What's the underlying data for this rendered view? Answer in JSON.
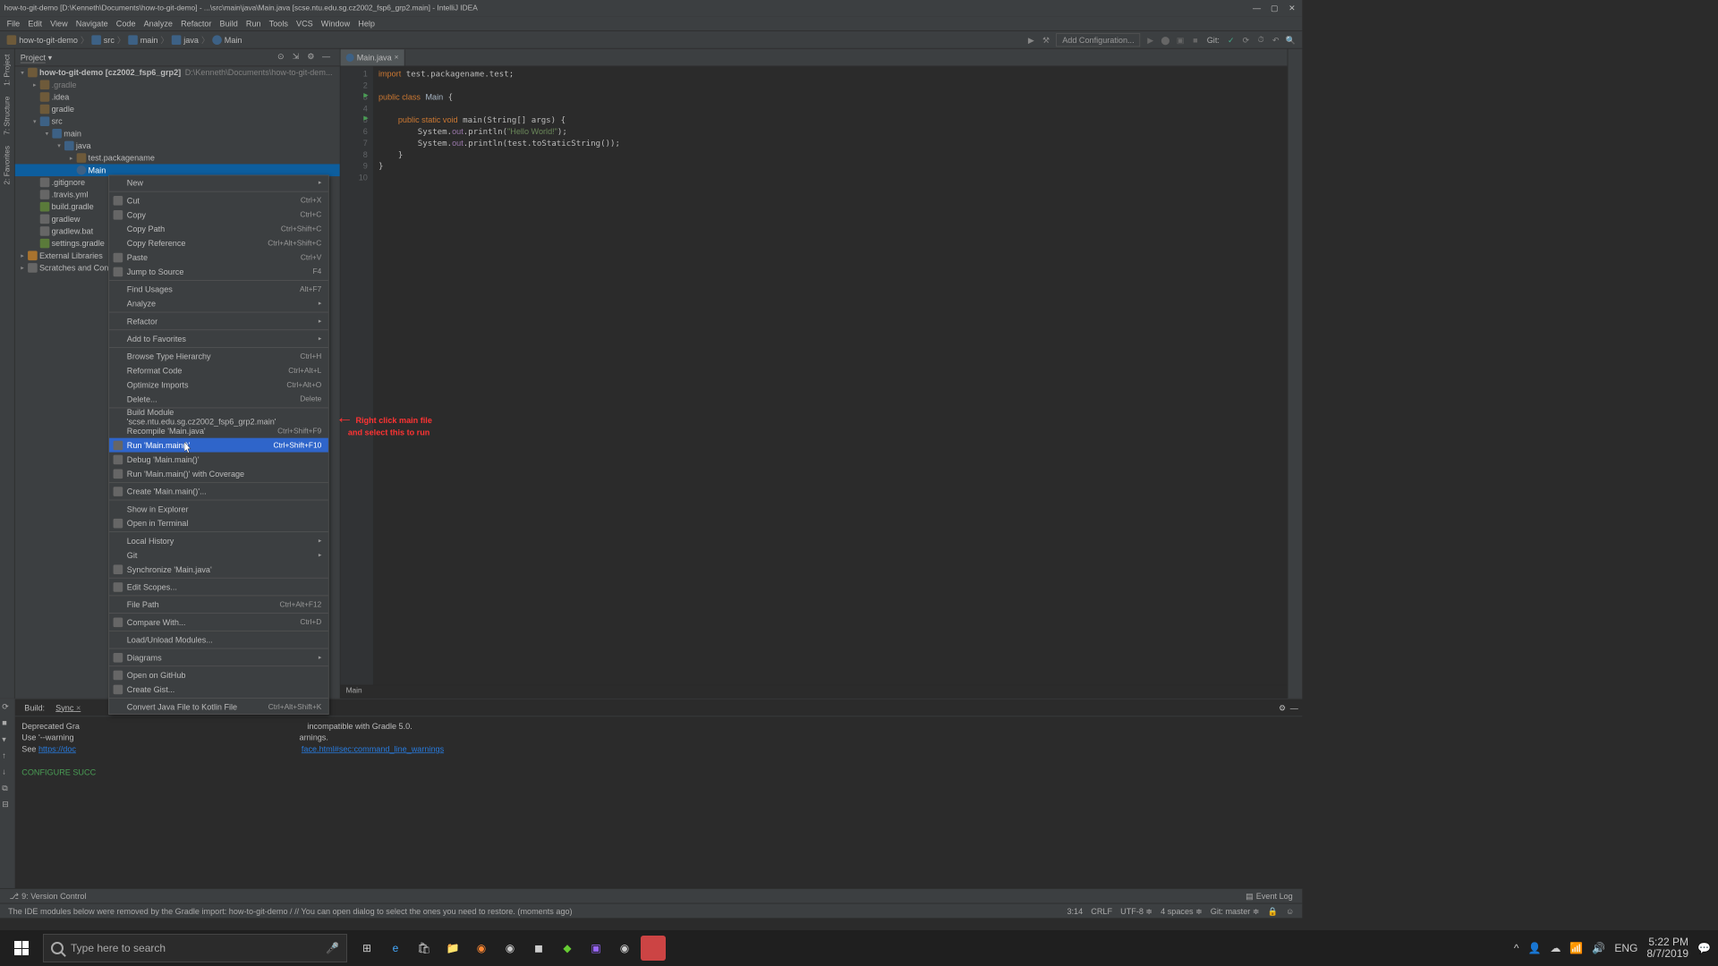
{
  "window": {
    "title": "how-to-git-demo [D:\\Kenneth\\Documents\\how-to-git-demo] - ...\\src\\main\\java\\Main.java [scse.ntu.edu.sg.cz2002_fsp6_grp2.main] - IntelliJ IDEA"
  },
  "menu": [
    "File",
    "Edit",
    "View",
    "Navigate",
    "Code",
    "Analyze",
    "Refactor",
    "Build",
    "Run",
    "Tools",
    "VCS",
    "Window",
    "Help"
  ],
  "breadcrumbs": [
    {
      "icon": "folder",
      "label": "how-to-git-demo"
    },
    {
      "icon": "bluefolder",
      "label": "src"
    },
    {
      "icon": "bluefolder",
      "label": "main"
    },
    {
      "icon": "bluefolder",
      "label": "java"
    },
    {
      "icon": "class",
      "label": "Main"
    }
  ],
  "toolbar": {
    "addConfig": "Add Configuration...",
    "gitLabel": "Git:"
  },
  "panel": {
    "title": "Project"
  },
  "tree": {
    "root": {
      "label": "how-to-git-demo [cz2002_fsp6_grp2]",
      "path": "D:\\Kenneth\\Documents\\how-to-git-dem..."
    },
    "items": [
      {
        "indent": 1,
        "arrow": "▸",
        "icon": "folder",
        "label": ".gradle",
        "dim": true
      },
      {
        "indent": 1,
        "arrow": "",
        "icon": "folder",
        "label": ".idea"
      },
      {
        "indent": 1,
        "arrow": "",
        "icon": "folder",
        "label": "gradle"
      },
      {
        "indent": 1,
        "arrow": "▾",
        "icon": "bluefolder",
        "label": "src"
      },
      {
        "indent": 2,
        "arrow": "▾",
        "icon": "bluefolder",
        "label": "main"
      },
      {
        "indent": 3,
        "arrow": "▾",
        "icon": "bluefolder",
        "label": "java"
      },
      {
        "indent": 4,
        "arrow": "▸",
        "icon": "folder",
        "label": "test.packagename"
      },
      {
        "indent": 4,
        "arrow": "",
        "icon": "class",
        "label": "Main",
        "sel": true
      },
      {
        "indent": 1,
        "arrow": "",
        "icon": "grayfile",
        "label": ".gitignore"
      },
      {
        "indent": 1,
        "arrow": "",
        "icon": "grayfile",
        "label": ".travis.yml"
      },
      {
        "indent": 1,
        "arrow": "",
        "icon": "file",
        "label": "build.gradle"
      },
      {
        "indent": 1,
        "arrow": "",
        "icon": "grayfile",
        "label": "gradlew"
      },
      {
        "indent": 1,
        "arrow": "",
        "icon": "grayfile",
        "label": "gradlew.bat"
      },
      {
        "indent": 1,
        "arrow": "",
        "icon": "file",
        "label": "settings.gradle"
      }
    ],
    "extlib": "External Libraries",
    "scratch": "Scratches and Cons..."
  },
  "tab": {
    "label": "Main.java"
  },
  "code": {
    "lines": [
      "import test.packagename.test;",
      "",
      "public class Main {",
      "",
      "    public static void main(String[] args) {",
      "        System.out.println(\"Hello World!\");",
      "        System.out.println(test.toStaticString());",
      "    }",
      "}",
      ""
    ]
  },
  "editorCrumb": "Main",
  "contextMenu": [
    {
      "label": "New",
      "sub": true
    },
    {
      "sep": true
    },
    {
      "label": "Cut",
      "sc": "Ctrl+X",
      "icon": true,
      "u": "t"
    },
    {
      "label": "Copy",
      "sc": "Ctrl+C",
      "icon": true,
      "u": "C"
    },
    {
      "label": "Copy Path",
      "sc": "Ctrl+Shift+C"
    },
    {
      "label": "Copy Reference",
      "sc": "Ctrl+Alt+Shift+C"
    },
    {
      "label": "Paste",
      "sc": "Ctrl+V",
      "icon": true,
      "u": "P"
    },
    {
      "label": "Jump to Source",
      "sc": "F4",
      "icon": true
    },
    {
      "sep": true
    },
    {
      "label": "Find Usages",
      "sc": "Alt+F7",
      "u": "U"
    },
    {
      "label": "Analyze",
      "sub": true
    },
    {
      "sep": true
    },
    {
      "label": "Refactor",
      "sub": true,
      "u": "R"
    },
    {
      "sep": true
    },
    {
      "label": "Add to Favorites",
      "sub": true
    },
    {
      "sep": true
    },
    {
      "label": "Browse Type Hierarchy",
      "sc": "Ctrl+H"
    },
    {
      "label": "Reformat Code",
      "sc": "Ctrl+Alt+L"
    },
    {
      "label": "Optimize Imports",
      "sc": "Ctrl+Alt+O"
    },
    {
      "label": "Delete...",
      "sc": "Delete"
    },
    {
      "sep": true
    },
    {
      "label": "Build Module 'scse.ntu.edu.sg.cz2002_fsp6_grp2.main'"
    },
    {
      "label": "Recompile 'Main.java'",
      "sc": "Ctrl+Shift+F9"
    },
    {
      "label": "Run 'Main.main()'",
      "sc": "Ctrl+Shift+F10",
      "highlight": true,
      "icon": true
    },
    {
      "label": "Debug 'Main.main()'",
      "icon": true
    },
    {
      "label": "Run 'Main.main()' with Coverage",
      "icon": true
    },
    {
      "sep": true
    },
    {
      "label": "Create 'Main.main()'...",
      "icon": true
    },
    {
      "sep": true
    },
    {
      "label": "Show in Explorer"
    },
    {
      "label": "Open in Terminal",
      "icon": true
    },
    {
      "sep": true
    },
    {
      "label": "Local History",
      "sub": true,
      "u": "H"
    },
    {
      "label": "Git",
      "sub": true,
      "u": "G"
    },
    {
      "label": "Synchronize 'Main.java'",
      "icon": true
    },
    {
      "sep": true
    },
    {
      "label": "Edit Scopes...",
      "icon": true
    },
    {
      "sep": true
    },
    {
      "label": "File Path",
      "sc": "Ctrl+Alt+F12"
    },
    {
      "sep": true
    },
    {
      "label": "Compare With...",
      "sc": "Ctrl+D",
      "icon": true
    },
    {
      "sep": true
    },
    {
      "label": "Load/Unload Modules..."
    },
    {
      "sep": true
    },
    {
      "label": "Diagrams",
      "sub": true,
      "icon": true
    },
    {
      "sep": true
    },
    {
      "label": "Open on GitHub",
      "icon": true
    },
    {
      "label": "Create Gist...",
      "icon": true
    },
    {
      "sep": true
    },
    {
      "label": "Convert Java File to Kotlin File",
      "sc": "Ctrl+Alt+Shift+K"
    }
  ],
  "annotation": {
    "arrow": "←",
    "line1": "Right click main file",
    "line2": "and select this to run"
  },
  "build": {
    "tabs": [
      "Build:",
      "Sync"
    ],
    "text1": "Deprecated Gra",
    "text1b": " incompatible with Gradle 5.0.",
    "text2": "Use '--warning",
    "text2b": "arnings.",
    "text3": "See ",
    "link": "https://doc",
    "link2": "face.html#sec:command_line_warnings",
    "text4": "CONFIGURE SUCC"
  },
  "bottomTools": {
    "vcs": "9: Version Control",
    "eventLog": "Event Log"
  },
  "status": {
    "msg": "The IDE modules below were removed by the Gradle import: how-to-git-demo / // You can open dialog to select the ones you need to restore. (moments ago)",
    "pos": "3:14",
    "eol": "CRLF",
    "enc": "UTF-8",
    "indent": "4 spaces",
    "branch": "Git: master"
  },
  "taskbar": {
    "search": "Type here to search",
    "time": "5:22 PM",
    "date": "8/7/2019",
    "lang": "ENG"
  }
}
